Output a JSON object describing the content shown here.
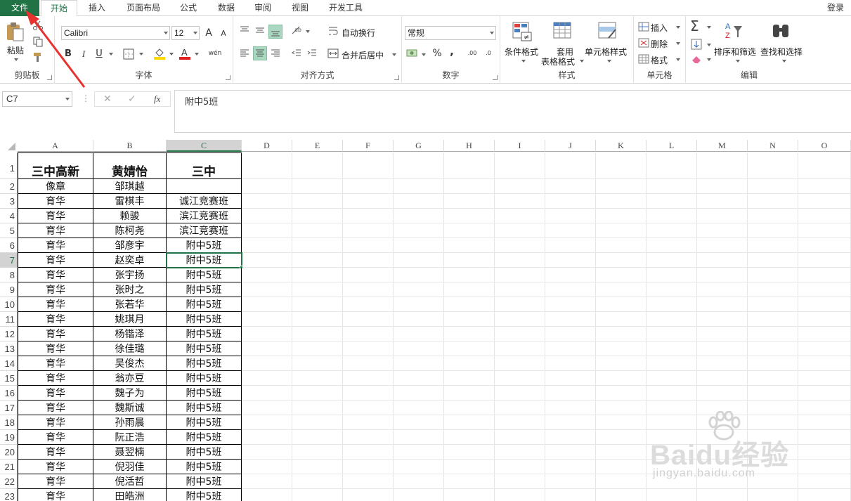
{
  "tabs": {
    "file": "文件",
    "items": [
      "开始",
      "插入",
      "页面布局",
      "公式",
      "数据",
      "审阅",
      "视图",
      "开发工具"
    ],
    "login": "登录"
  },
  "ribbon": {
    "clipboard": {
      "label": "剪贴板",
      "paste": "粘贴"
    },
    "font": {
      "label": "字体",
      "name": "Calibri",
      "size": "12",
      "bold": "B",
      "italic": "I",
      "underline": "U",
      "larger": "A",
      "smaller": "A",
      "phonetic": "wén"
    },
    "alignment": {
      "label": "对齐方式",
      "wrap": "自动换行",
      "merge": "合并后居中"
    },
    "number": {
      "label": "数字",
      "format": "常规",
      "percent": "%",
      "comma": ",",
      "inc_decimal": ".00",
      "dec_decimal": ".0"
    },
    "styles": {
      "label": "样式",
      "conditional": "条件格式",
      "table_line1": "套用",
      "table_line2": "表格格式",
      "cell_styles": "单元格样式"
    },
    "cells": {
      "label": "单元格",
      "insert": "插入",
      "delete": "删除",
      "format": "格式"
    },
    "editing": {
      "label": "编辑",
      "sort": "排序和筛选",
      "find": "查找和选择"
    }
  },
  "formula_bar": {
    "name_box": "C7",
    "fx": "fx",
    "content": "附中5班"
  },
  "sheet": {
    "columns": [
      "A",
      "B",
      "C",
      "D",
      "E",
      "F",
      "G",
      "H",
      "I",
      "J",
      "K",
      "L",
      "M",
      "N",
      "O"
    ],
    "selected_column": "C",
    "selected_row": 7,
    "rows": [
      {
        "n": "1",
        "a": "三中高新",
        "b": "黄婧怡",
        "c": "三中"
      },
      {
        "n": "2",
        "a": "像章",
        "b": "邹琪越",
        "c": ""
      },
      {
        "n": "3",
        "a": "育华",
        "b": "雷棋丰",
        "c": "诚江竞赛班"
      },
      {
        "n": "4",
        "a": "育华",
        "b": "赖骏",
        "c": "滨江竞赛班"
      },
      {
        "n": "5",
        "a": "育华",
        "b": "陈柯尧",
        "c": "滨江竞赛班"
      },
      {
        "n": "6",
        "a": "育华",
        "b": "邹彦宇",
        "c": "附中5班"
      },
      {
        "n": "7",
        "a": "育华",
        "b": "赵奕卓",
        "c": "附中5班"
      },
      {
        "n": "8",
        "a": "育华",
        "b": "张宇扬",
        "c": "附中5班"
      },
      {
        "n": "9",
        "a": "育华",
        "b": "张时之",
        "c": "附中5班"
      },
      {
        "n": "10",
        "a": "育华",
        "b": "张若华",
        "c": "附中5班"
      },
      {
        "n": "11",
        "a": "育华",
        "b": "姚琪月",
        "c": "附中5班"
      },
      {
        "n": "12",
        "a": "育华",
        "b": "杨锴泽",
        "c": "附中5班"
      },
      {
        "n": "13",
        "a": "育华",
        "b": "徐佳璐",
        "c": "附中5班"
      },
      {
        "n": "14",
        "a": "育华",
        "b": "吴俊杰",
        "c": "附中5班"
      },
      {
        "n": "15",
        "a": "育华",
        "b": "翁亦豆",
        "c": "附中5班"
      },
      {
        "n": "16",
        "a": "育华",
        "b": "魏子为",
        "c": "附中5班"
      },
      {
        "n": "17",
        "a": "育华",
        "b": "魏斯诚",
        "c": "附中5班"
      },
      {
        "n": "18",
        "a": "育华",
        "b": "孙雨晨",
        "c": "附中5班"
      },
      {
        "n": "19",
        "a": "育华",
        "b": "阮正浩",
        "c": "附中5班"
      },
      {
        "n": "20",
        "a": "育华",
        "b": "聂翌楠",
        "c": "附中5班"
      },
      {
        "n": "21",
        "a": "育华",
        "b": "倪羽佳",
        "c": "附中5班"
      },
      {
        "n": "22",
        "a": "育华",
        "b": "倪活哲",
        "c": "附中5班"
      },
      {
        "n": "23",
        "a": "育华",
        "b": "田皓洲",
        "c": "附中5班"
      }
    ]
  },
  "watermark": {
    "brand": "Baidu经验",
    "url": "jingyan.baidu.com"
  },
  "colors": {
    "accent": "#217346",
    "arrow": "#e8322f"
  }
}
